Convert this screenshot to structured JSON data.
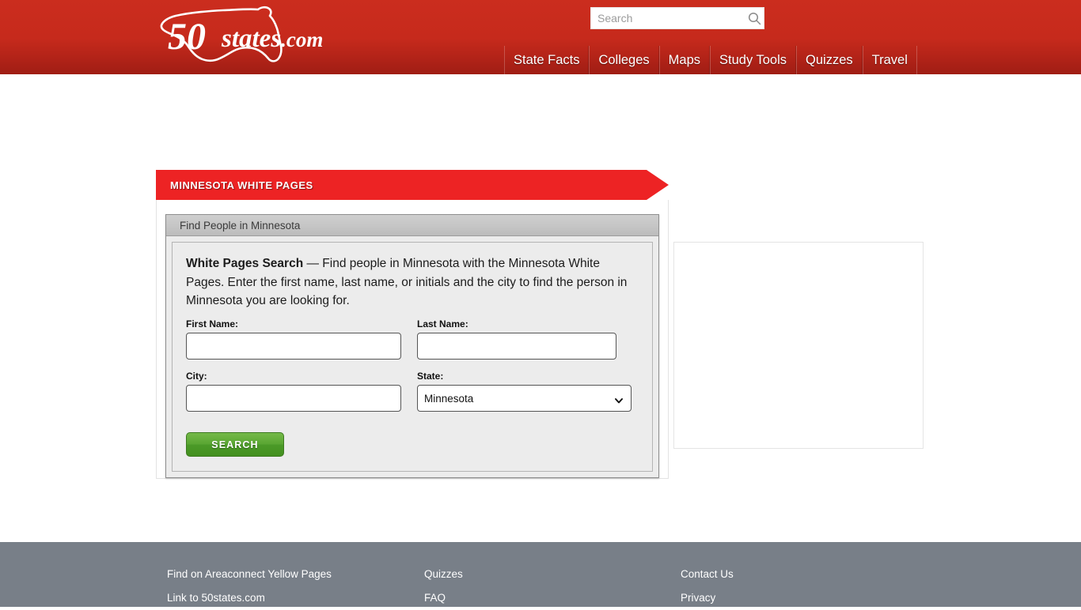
{
  "header": {
    "logo": {
      "number": "50",
      "word": "states",
      "tld": ".com",
      "alt_name": "50states-logo"
    },
    "search": {
      "placeholder": "Search",
      "value": "",
      "icon": "search-icon"
    },
    "nav": [
      {
        "label": "State Facts"
      },
      {
        "label": "Colleges"
      },
      {
        "label": "Maps"
      },
      {
        "label": "Study Tools"
      },
      {
        "label": "Quizzes"
      },
      {
        "label": "Travel"
      }
    ],
    "colors": {
      "header_top": "#cb2d1e",
      "header_bottom": "#9f1d14"
    }
  },
  "main": {
    "banner_title": "MINNESOTA WHITE PAGES",
    "banner_color": "#ed2324",
    "panel": {
      "box_header": "Find People in Minnesota",
      "description_bold": "White Pages Search",
      "description_rest": " — Find people in Minnesota with the Minnesota White Pages. Enter the first name, last name, or initials and the city to find the person in Minnesota you are looking for.",
      "fields": {
        "first_name_label": "First Name:",
        "first_name_value": "",
        "last_name_label": "Last Name:",
        "last_name_value": "",
        "city_label": "City:",
        "city_value": "",
        "state_label": "State:",
        "state_value": "Minnesota"
      },
      "submit_label": "SEARCH",
      "submit_color": "#55a32e"
    }
  },
  "footer": {
    "background": "#787f88",
    "columns": [
      {
        "links": [
          "Find on Areaconnect Yellow Pages",
          "Link to 50states.com"
        ]
      },
      {
        "links": [
          "Quizzes",
          "FAQ"
        ]
      },
      {
        "links": [
          "Contact Us",
          "Privacy"
        ]
      }
    ]
  }
}
